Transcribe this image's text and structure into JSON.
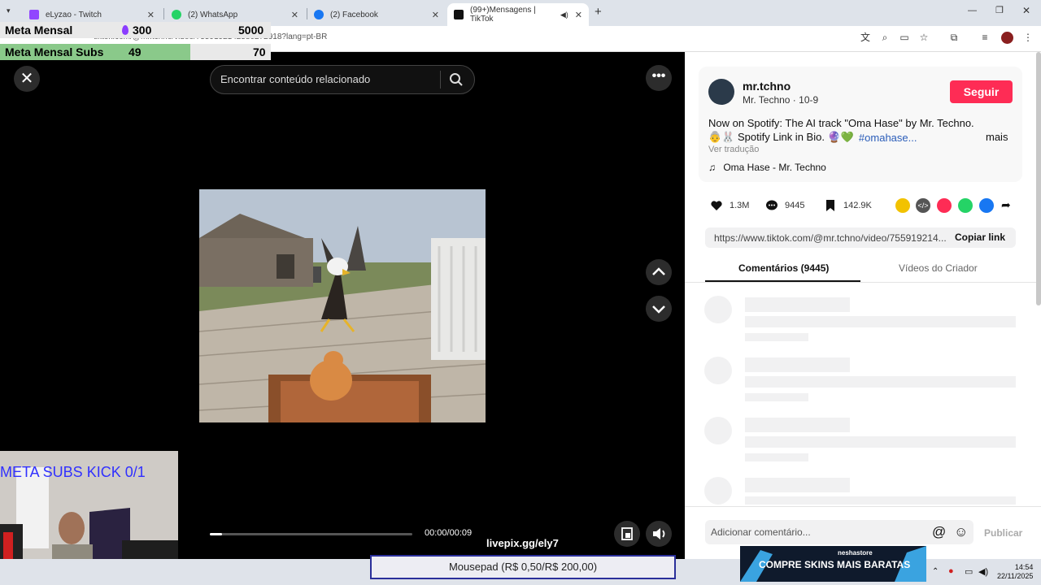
{
  "browser": {
    "tabs": [
      {
        "title": "eLyzao - Twitch",
        "icon": "twitch-icon",
        "color": "#9146ff"
      },
      {
        "title": "(2) WhatsApp",
        "icon": "whatsapp-icon",
        "color": "#25d366"
      },
      {
        "title": "(2) Facebook",
        "icon": "facebook-icon",
        "color": "#1877f2"
      },
      {
        "title": "(99+)Mensagens | TikTok",
        "icon": "tiktok-icon",
        "color": "#111111"
      }
    ],
    "url": "tiktok.com/@mr.tchno/video/7559192142580272918?lang=pt-BR"
  },
  "overlay": {
    "goal1_label": "Meta Mensal",
    "goal1_current": "300",
    "goal1_target": "5000",
    "goal2_label": "Meta Mensal Subs",
    "goal2_current": "49",
    "goal2_target": "70",
    "webcam_text": "META SUBS KICK 0/1",
    "livepix": "livepix.gg/ely7",
    "mousepad": "Mousepad (R$ 0,50/R$ 200,00)"
  },
  "player": {
    "search_placeholder": "Encontrar conteúdo relacionado",
    "time": "00:00/00:09",
    "progress_fraction": 0.06
  },
  "post": {
    "username": "mr.tchno",
    "display_name": "Mr. Techno · 10-9",
    "follow_label": "Seguir",
    "desc_line1": "Now on Spotify: The AI track \"Oma Hase\" by Mr. Techno.",
    "desc_line2": "👵🐰 Spotify Link in Bio. 🔮💚",
    "hashtag": "#omahase...",
    "more_label": "mais",
    "translate_label": "Ver tradução",
    "music": "Oma Hase - Mr. Techno",
    "likes": "1.3M",
    "comments": "9445",
    "saves": "142.9K",
    "link": "https://www.tiktok.com/@mr.tchno/video/755919214...",
    "copy_label": "Copiar link",
    "tab_comments": "Comentários (9445)",
    "tab_creator": "Vídeos do Criador",
    "comment_placeholder": "Adicionar comentário...",
    "publish_label": "Publicar"
  },
  "taskbar": {
    "ad_small": "neshastore",
    "ad_text": "COMPRE SKINS MAIS BARATAS",
    "time": "14:54",
    "date": "22/11/2025"
  },
  "colors": {
    "follow": "#fe2c55",
    "hashtag": "#2b5db9",
    "goal_fill": "#8ac98a"
  }
}
